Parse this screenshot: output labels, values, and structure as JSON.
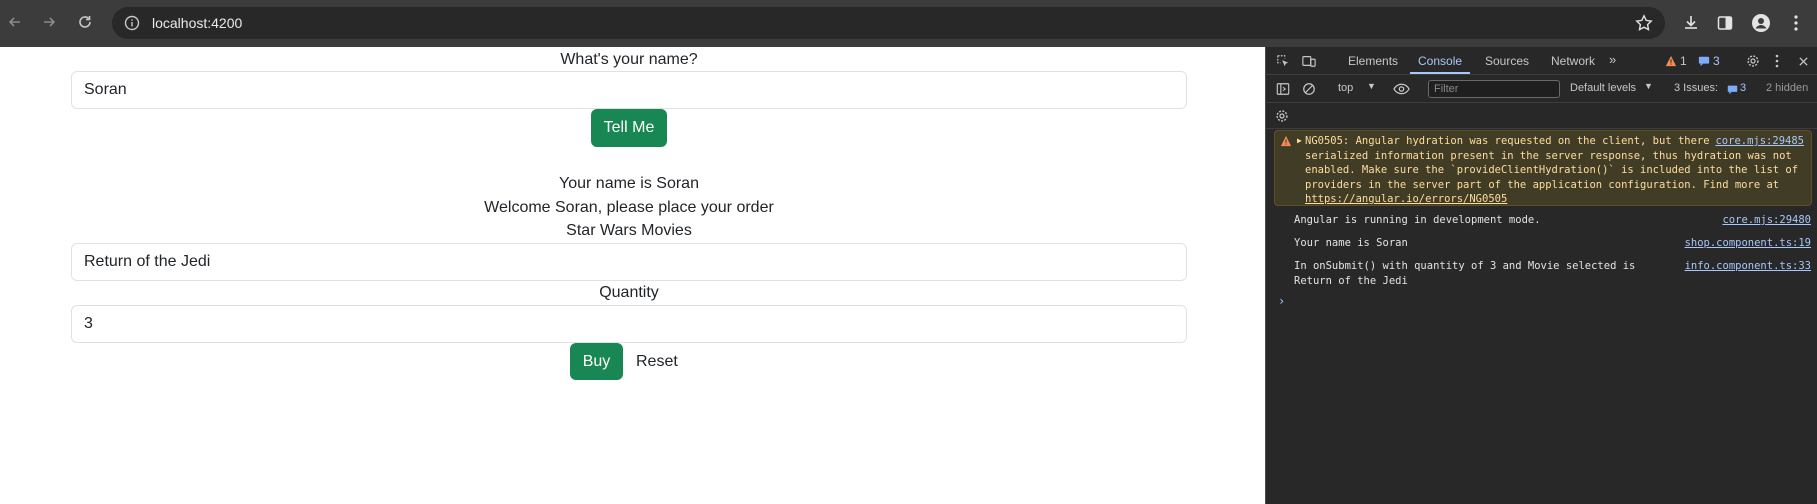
{
  "browser": {
    "url": "localhost:4200",
    "icons": [
      "back-icon",
      "forward-icon",
      "reload-icon",
      "info-icon",
      "star-icon",
      "download-icon",
      "side-panel-icon",
      "profile-icon",
      "menu-icon"
    ]
  },
  "page": {
    "name_prompt": "What's your name?",
    "name_value": "Soran",
    "tell_me_label": "Tell Me",
    "your_name_line": "Your name is Soran",
    "welcome_line": "Welcome Soran, please place your order",
    "movies_label": "Star Wars Movies",
    "movie_value": "Return of the Jedi",
    "quantity_label": "Quantity",
    "quantity_value": "3",
    "buy_label": "Buy",
    "reset_label": "Reset",
    "accent_color": "#198754"
  },
  "devtools": {
    "tabs": [
      "Elements",
      "Console",
      "Sources",
      "Network"
    ],
    "active_tab": "Console",
    "warning_count": "1",
    "message_count": "3",
    "context": "top",
    "filter_placeholder": "Filter",
    "levels": "Default levels",
    "issues_label": "3 Issues:",
    "issues_count": "3",
    "hidden_label": "2 hidden",
    "messages": {
      "warning": {
        "text": "NG0505: Angular hydration was requested on the client, but there was no serialized information present in the server response, thus hydration was not enabled. Make sure the `provideClientHydration()` is included into the list of providers in the server part of the application configuration. Find more at ",
        "link": "https://angular.io/errors/NG0505",
        "source": "core.mjs:29485"
      },
      "log1": {
        "text": "Angular is running in development mode.",
        "source": "core.mjs:29480"
      },
      "log2": {
        "text": "Your name is Soran",
        "source": "shop.component.ts:19"
      },
      "log3": {
        "text": "In onSubmit() with quantity of 3 and Movie selected is",
        "text2": "Return of the Jedi",
        "source": "info.component.ts:33"
      }
    },
    "warning_color": "#ffdd9e",
    "link_color": "#a8c7fa"
  }
}
